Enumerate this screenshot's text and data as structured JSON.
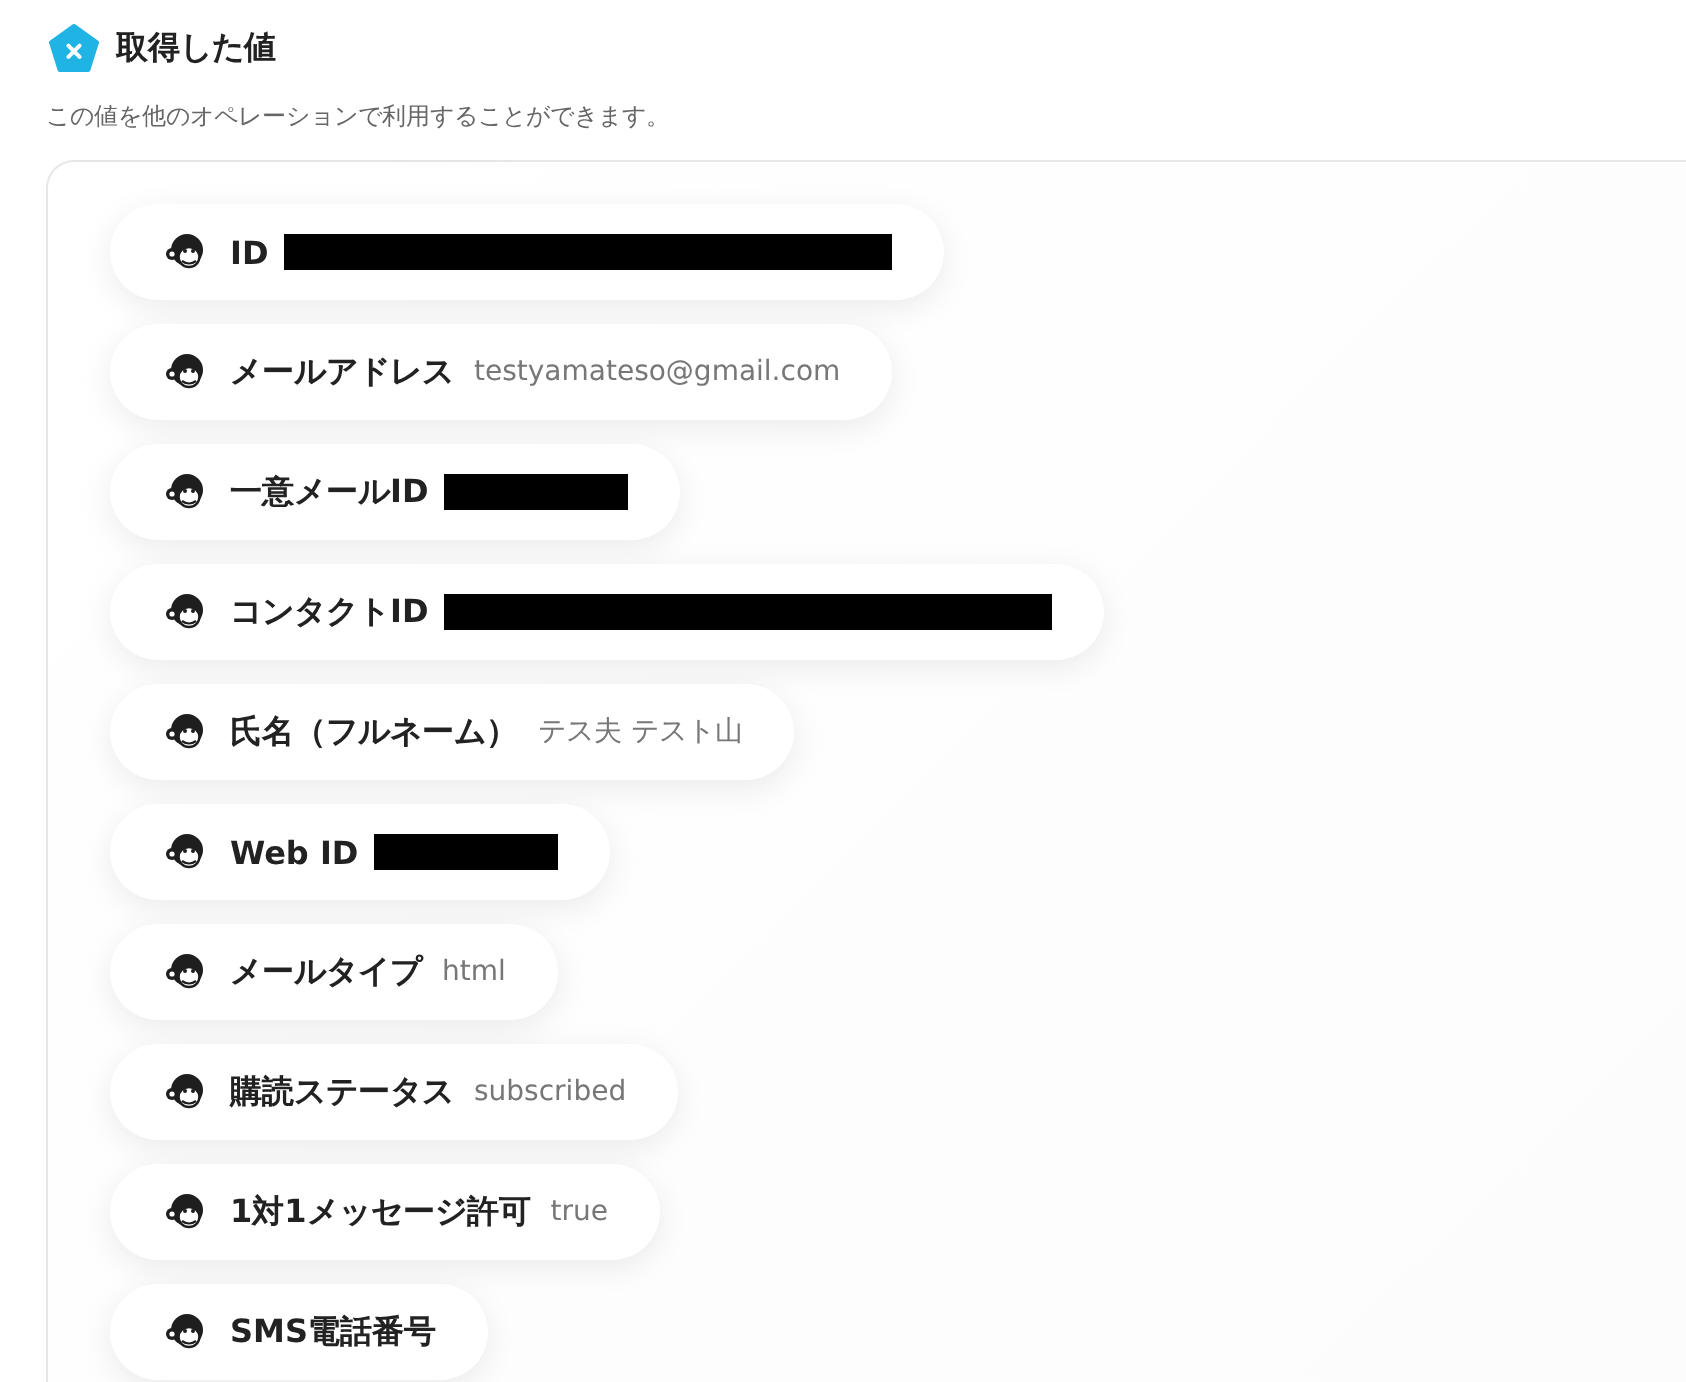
{
  "section": {
    "title": "取得した値",
    "description": "この値を他のオペレーションで利用することができます。",
    "items": [
      {
        "kind": "longmask",
        "label": "ID"
      },
      {
        "kind": "value",
        "label": "メールアドレス",
        "value": "testyamateso@gmail.com"
      },
      {
        "kind": "shortmask",
        "label": "一意メールID"
      },
      {
        "kind": "longmask",
        "label": "コンタクトID"
      },
      {
        "kind": "value",
        "label": "氏名（フルネーム）",
        "value": "テス夫 テスト山"
      },
      {
        "kind": "shortmask",
        "label": "Web ID"
      },
      {
        "kind": "value",
        "label": "メールタイプ",
        "value": "html"
      },
      {
        "kind": "value",
        "label": "購読ステータス",
        "value": "subscribed"
      },
      {
        "kind": "value",
        "label": "1対1メッセージ許可",
        "value": "true"
      },
      {
        "kind": "value",
        "label": "SMS電話番号"
      }
    ]
  }
}
